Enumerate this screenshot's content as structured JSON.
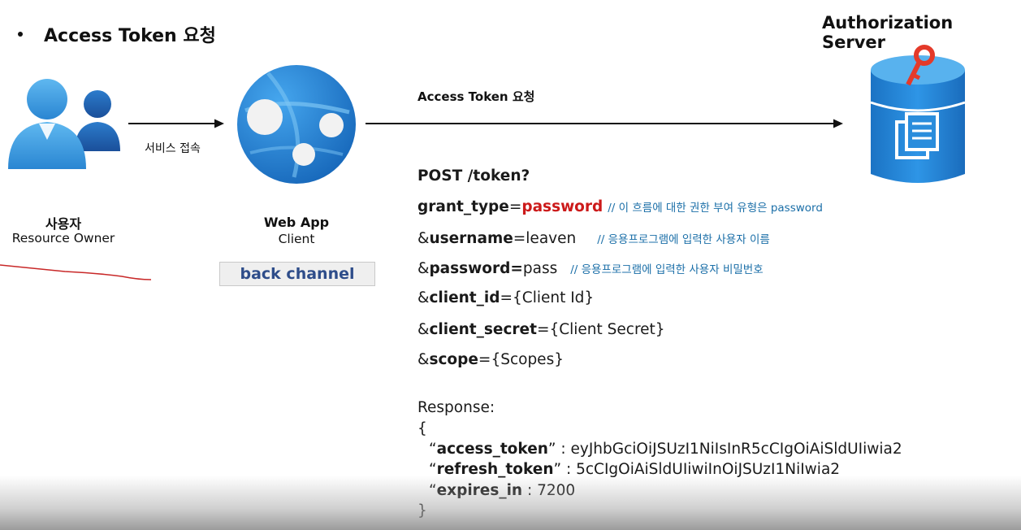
{
  "slide": {
    "bullet": "•",
    "title": "Access Token 요청"
  },
  "server": {
    "title": "Authorization Server",
    "icon": "database-key-document-icon"
  },
  "user": {
    "label_ko": "사용자",
    "label_en": "Resource Owner",
    "icon": "users-icon"
  },
  "client": {
    "label_app": "Web App",
    "label_role": "Client",
    "icon": "web-app-globe-icon"
  },
  "arrows": {
    "user_to_client": "서비스 접속",
    "client_to_server": "Access Token 요청"
  },
  "channel_label": "back channel",
  "request": {
    "line1": "POST /token?",
    "grant_key": "grant_type",
    "grant_eq": "=",
    "grant_val": "password",
    "grant_cmt": "// 이 흐름에 대한 권한 부여 유형은 password",
    "user_amp": "&",
    "user_key": "username",
    "user_eq": "=",
    "user_val": "leaven",
    "user_cmt": "// 응용프로그램에 입력한 사용자 이름",
    "pass_amp": "&",
    "pass_key": "password=",
    "pass_val": "pass",
    "pass_cmt": "// 응용프로그램에 입력한 사용자 비밀번호",
    "cid_amp": "&",
    "cid_key": "client_id",
    "cid_eq": "=",
    "cid_val": "{Client Id}",
    "csec_amp": "&",
    "csec_key": "client_secret",
    "csec_eq": "=",
    "csec_val": "{Client Secret}",
    "scope_amp": "&",
    "scope_key": "scope",
    "scope_eq": "=",
    "scope_val": "{Scopes}"
  },
  "response": {
    "label": "Response:",
    "open": "{",
    "at_q": "“",
    "at_key": "access_token",
    "at_sep": "” : ",
    "at_val": "eyJhbGciOiJSUzI1NiIsInR5cCIgOiAiSldUIiwia2",
    "rt_q": "“",
    "rt_key": "refresh_token",
    "rt_sep": "” : ",
    "rt_val": "5cCIgOiAiSldUIiwiInOiJSUzI1NiIwia2",
    "ex_q": "“",
    "ex_key": "expires_in",
    "ex_sep": " : ",
    "ex_val": "7200",
    "close": "}"
  },
  "colors": {
    "accent_red": "#cc1a1a",
    "comment_blue": "#1b6fa8",
    "channel_text": "#2e4d8a",
    "icon_blue": "#2c8ad6"
  }
}
